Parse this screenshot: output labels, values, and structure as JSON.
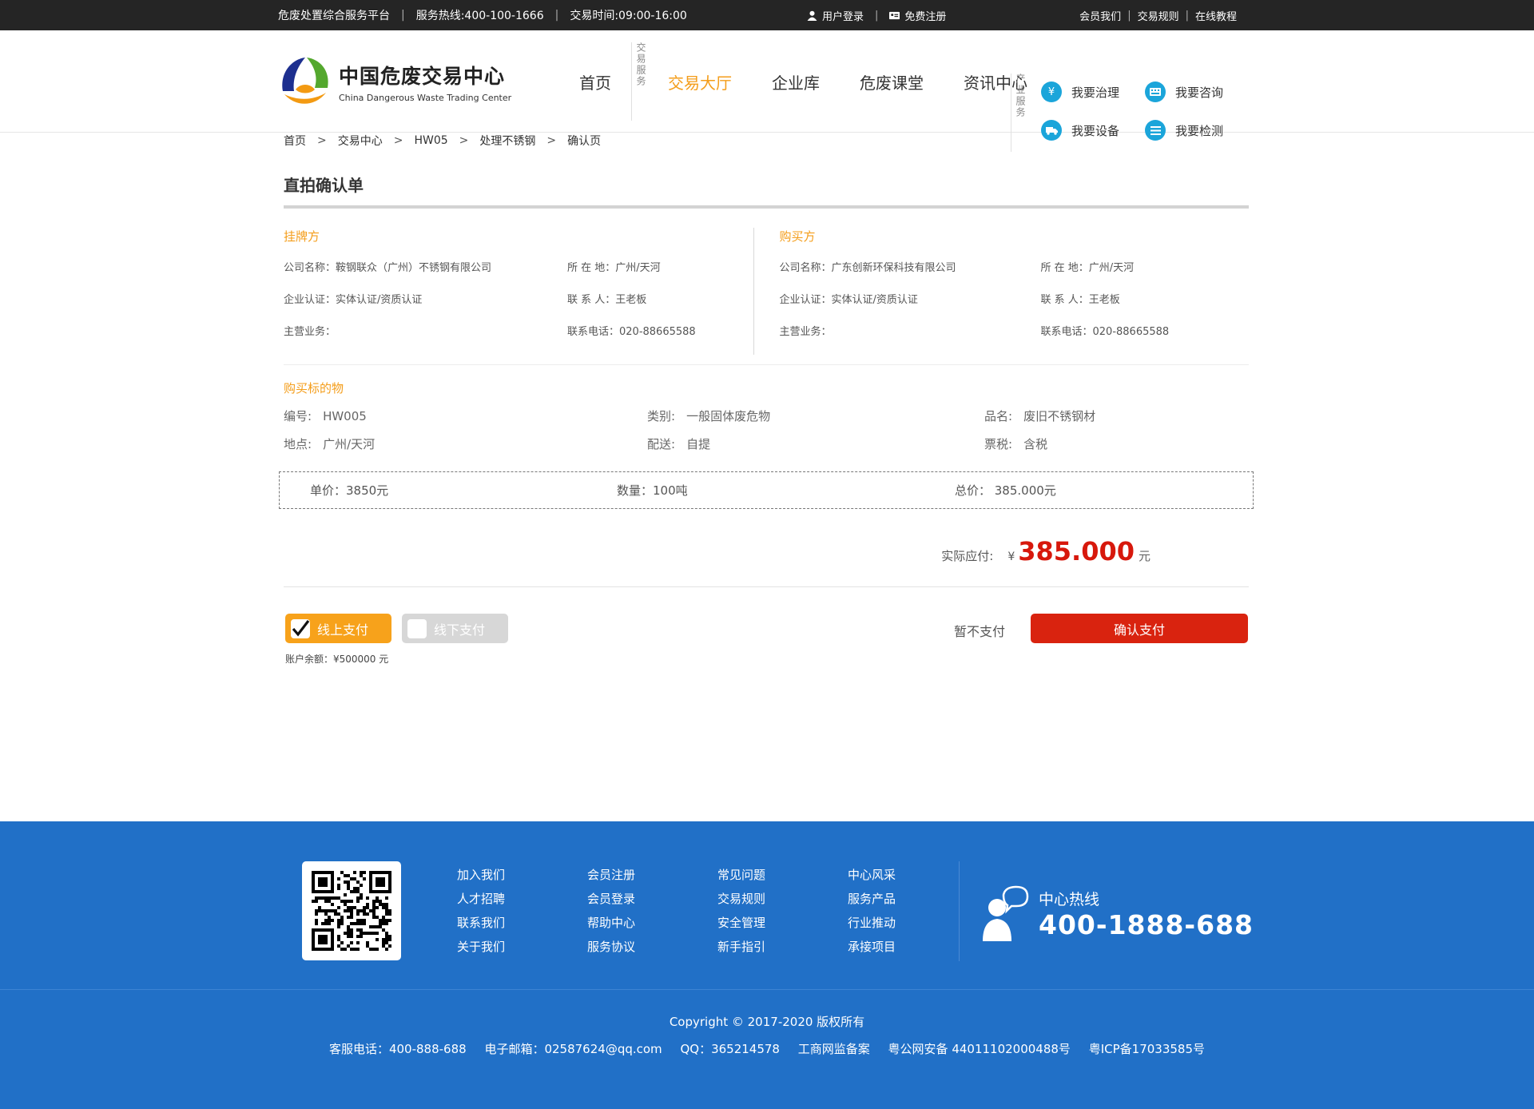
{
  "topbar": {
    "platform": "危废处置综合服务平台",
    "hotline": "服务热线:400-100-1666",
    "hours": "交易时间:09:00-16:00",
    "login": "用户登录",
    "register": "免费注册",
    "links": [
      "会员我们",
      "交易规则",
      "在线教程"
    ]
  },
  "logo": {
    "cn": "中国危废交易中心",
    "en": "China Dangerous Waste Trading Center"
  },
  "nav": {
    "home": "首页",
    "tag1": "交易服务",
    "items": [
      "交易大厅",
      "企业库",
      "危废课堂",
      "资讯中心"
    ],
    "tag2": "产业服务"
  },
  "services": [
    {
      "label": "我要治理",
      "icon": "yen-icon"
    },
    {
      "label": "我要咨询",
      "icon": "keyboard-icon"
    },
    {
      "label": "我要设备",
      "icon": "truck-icon"
    },
    {
      "label": "我要检测",
      "icon": "list-icon"
    }
  ],
  "breadcrumb": [
    "首页",
    "交易中心",
    "HW05",
    "处理不锈钢",
    "确认页"
  ],
  "page_title": "直拍确认单",
  "seller": {
    "title": "挂牌方",
    "company": "公司名称：鞍钢联众（广州）不锈钢有限公司",
    "location": "所 在 地：广州/天河",
    "cert": "企业认证：实体认证/资质认证",
    "contact": "联 系 人：王老板",
    "business": "主营业务：",
    "phone": "联系电话：020-88665588"
  },
  "buyer": {
    "title": "购买方",
    "company": "公司名称：广东创新环保科技有限公司",
    "location": "所 在 地：广州/天河",
    "cert": "企业认证：实体认证/资质认证",
    "contact": "联 系 人：王老板",
    "business": "主营业务：",
    "phone": "联系电话：020-88665588"
  },
  "goods": {
    "title": "购买标的物",
    "id_label": "编号:",
    "id": "HW005",
    "category_label": "类别:",
    "category": "一般固体废危物",
    "name_label": "品名:",
    "name": "废旧不锈钢材",
    "place_label": "地点:",
    "place": "广州/天河",
    "delivery_label": "配送:",
    "delivery": "自提",
    "tax_label": "票税:",
    "tax": "含税"
  },
  "price": {
    "unit": "单价：3850元",
    "qty": "数量：100吨",
    "total": "总价：  385.000元"
  },
  "payable": {
    "label": "实际应付:",
    "currency": "¥",
    "amount": "385.000",
    "unit": "元"
  },
  "pay": {
    "online": "线上支付",
    "offline": "线下支付",
    "balance": "账户余额：¥500000 元",
    "later": "暂不支付",
    "confirm": "确认支付"
  },
  "footer": {
    "cols": [
      [
        "加入我们",
        "人才招聘",
        "联系我们",
        "关于我们"
      ],
      [
        "会员注册",
        "会员登录",
        "帮助中心",
        "服务协议"
      ],
      [
        "常见问题",
        "交易规则",
        "安全管理",
        "新手指引"
      ],
      [
        "中心风采",
        "服务产品",
        "行业推动",
        "承接项目"
      ]
    ],
    "hotline_label": "中心热线",
    "hotline": "400-1888-688",
    "copyright": "Copyright © 2017-2020  版权所有",
    "info": [
      "客服电话：400-888-688",
      "电子邮箱：02587624@qq.com",
      "QQ：365214578",
      "工商网监备案",
      "粤公网安备 44011102000488号",
      "粤ICP备17033585号"
    ]
  },
  "colors": {
    "accent": "#f49d1a",
    "confirm": "#d9230f",
    "footer": "#2170c7",
    "service_icon": "#1ba5da"
  }
}
